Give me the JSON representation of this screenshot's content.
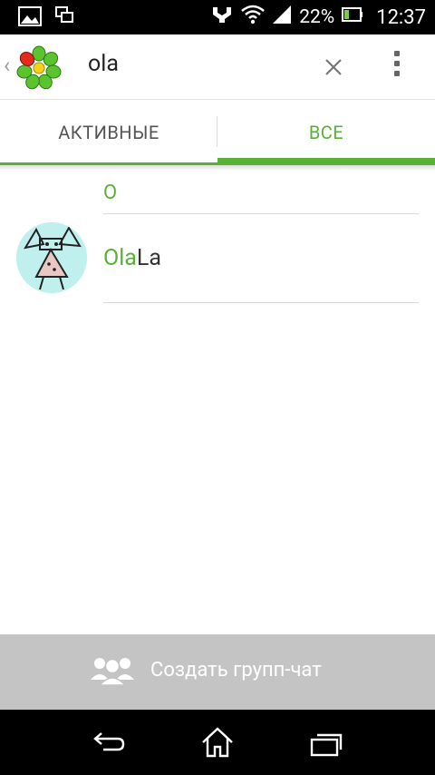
{
  "status_bar": {
    "battery": "22%",
    "time": "12:37"
  },
  "toolbar": {
    "search_query": "ola"
  },
  "tabs": [
    {
      "label": "АКТИВНЫЕ",
      "selected": false
    },
    {
      "label": "ВСЕ",
      "selected": true
    }
  ],
  "results": {
    "section_letter": "O",
    "contacts": [
      {
        "name_match": "Ola",
        "name_rest": "La"
      }
    ]
  },
  "actions": {
    "create_group_chat": "Создать групп-чат"
  },
  "colors": {
    "accent": "#58b135",
    "status_bar_bg": "#000000",
    "action_bar_bg": "#c4c4c4"
  },
  "icons": {
    "status_left": [
      "gallery-icon",
      "screen-mirror-icon"
    ],
    "status_right": [
      "usb-debug-icon",
      "wifi-icon",
      "signal-icon",
      "battery-icon"
    ],
    "toolbar": [
      "back-chevron-icon",
      "icq-flower-logo",
      "close-icon",
      "overflow-menu-icon"
    ],
    "nav": [
      "back-icon",
      "home-icon",
      "recents-icon"
    ]
  }
}
